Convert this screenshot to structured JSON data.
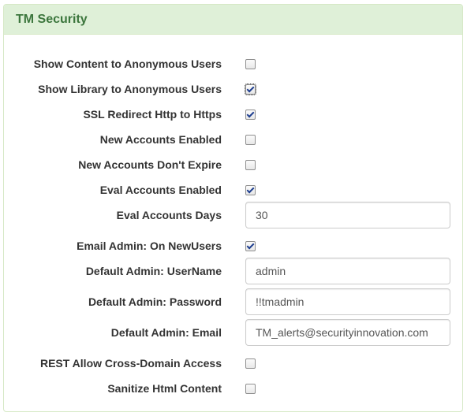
{
  "panel": {
    "title": "TM Security"
  },
  "settings": [
    {
      "label": "Show Content to Anonymous Users",
      "type": "checkbox",
      "checked": false
    },
    {
      "label": "Show Library to Anonymous Users",
      "type": "checkbox",
      "checked": true,
      "focused": true
    },
    {
      "label": "SSL Redirect Http to Https",
      "type": "checkbox",
      "checked": true
    },
    {
      "label": "New Accounts Enabled",
      "type": "checkbox",
      "checked": false
    },
    {
      "label": "New Accounts Don't Expire",
      "type": "checkbox",
      "checked": false
    },
    {
      "label": "Eval Accounts Enabled",
      "type": "checkbox",
      "checked": true
    },
    {
      "label": "Eval Accounts Days",
      "type": "text",
      "value": "30"
    },
    {
      "label": "Email Admin: On NewUsers",
      "type": "checkbox",
      "checked": true
    },
    {
      "label": "Default Admin: UserName",
      "type": "text",
      "value": "admin"
    },
    {
      "label": "Default Admin: Password",
      "type": "text",
      "value": "!!tmadmin"
    },
    {
      "label": "Default Admin: Email",
      "type": "text",
      "value": "TM_alerts@securityinnovation.com"
    },
    {
      "label": "REST Allow Cross-Domain Access",
      "type": "checkbox",
      "checked": false
    },
    {
      "label": "Sanitize Html Content",
      "type": "checkbox",
      "checked": false
    }
  ]
}
